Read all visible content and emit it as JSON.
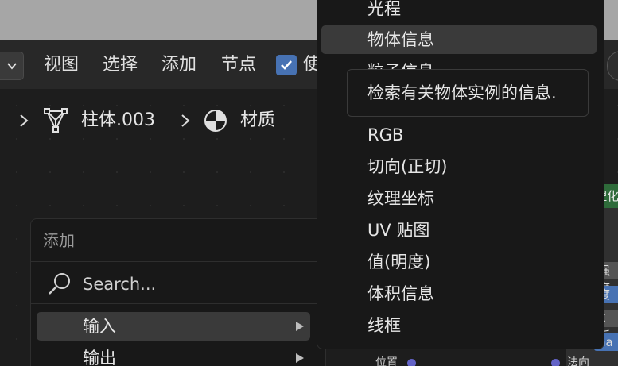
{
  "header": {
    "menus": [
      "视图",
      "选择",
      "添加",
      "节点"
    ],
    "checkbox_label_partial": "使"
  },
  "breadcrumb": {
    "object": "柱体.003",
    "material": "材质"
  },
  "add_menu": {
    "title": "添加",
    "search_placeholder": "Search...",
    "items": [
      "输入",
      "输出"
    ]
  },
  "input_submenu": {
    "items": [
      "光程",
      "物体信息",
      "粒子信息",
      "RGB",
      "切向(正切)",
      "纹理坐标",
      "UV 贴图",
      "值(明度)",
      "体积信息",
      "线框"
    ],
    "highlighted": "物体信息",
    "tooltip": "检索有关物体实例的信息."
  },
  "node_fragments": {
    "right": [
      "理化",
      "强度",
      "度",
      "X 折",
      "ha"
    ],
    "bottom_left": "位置",
    "bottom_right": "法向"
  },
  "colors": {
    "accent": "#4772b3",
    "menu_bg": "#181818",
    "highlight": "#3a3a3a"
  }
}
